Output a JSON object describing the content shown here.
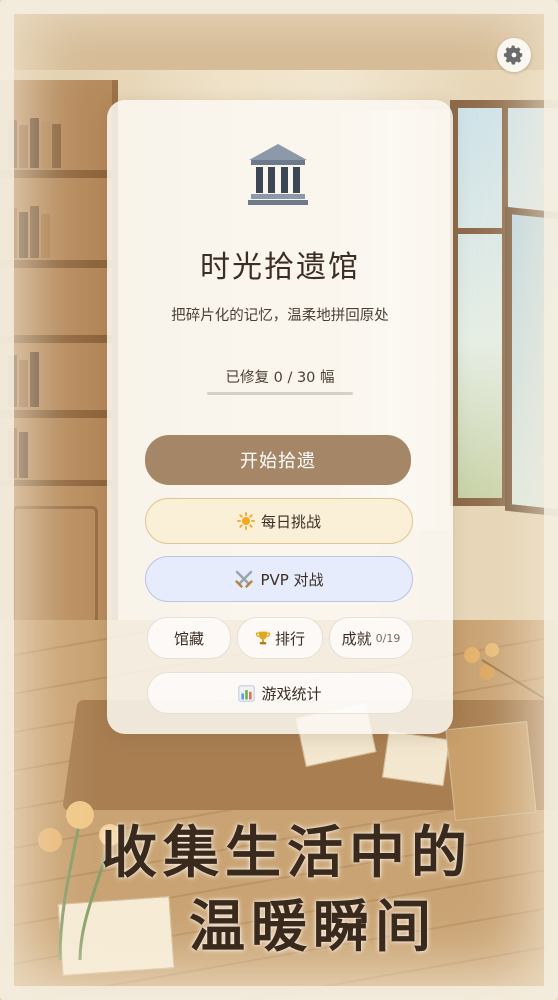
{
  "app": {
    "title": "时光拾遗馆",
    "subtitle": "把碎片化的记忆，温柔地拼回原处"
  },
  "progress": {
    "label": "已修复 0 / 30 幅",
    "repaired": 0,
    "total": 30,
    "fraction": 0.0
  },
  "buttons": {
    "start": "开始拾遗",
    "daily": "每日挑战",
    "pvp": "PVP 对战",
    "collection": "馆藏",
    "ranking": "排行",
    "achievements": "成就",
    "achievements_count": "0/19",
    "stats": "游戏统计"
  },
  "icons": {
    "settings": "gear-icon",
    "logo": "museum-icon",
    "daily": "sun-icon",
    "pvp": "crossed-swords-icon",
    "ranking": "trophy-icon",
    "stats": "bar-chart-icon"
  },
  "slogan": {
    "line1": "收集生活中的",
    "line2": "温暖瞬间"
  },
  "colors": {
    "primary_button": "#a58767",
    "daily_bg": "#faf0d8",
    "pvp_bg": "#e6ecfb",
    "text": "#3b2e24"
  }
}
